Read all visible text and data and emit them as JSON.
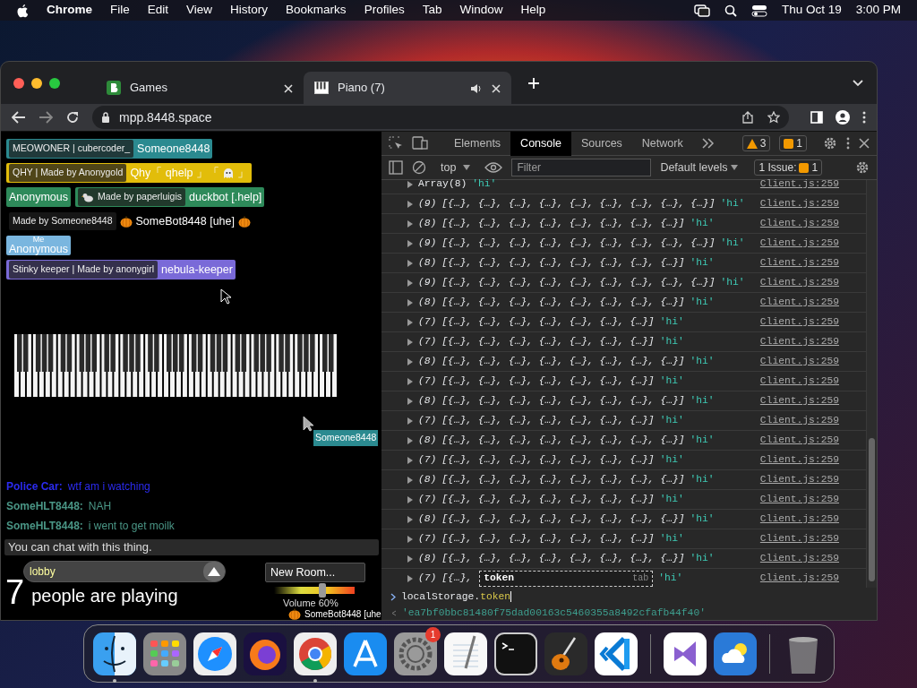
{
  "menubar": {
    "app": "Chrome",
    "menus": [
      "File",
      "Edit",
      "View",
      "History",
      "Bookmarks",
      "Profiles",
      "Tab",
      "Window",
      "Help"
    ],
    "date": "Thu Oct 19",
    "time": "3:00 PM"
  },
  "browser": {
    "tabs": [
      {
        "title": "Games",
        "selected": false,
        "audio": false
      },
      {
        "title": "Piano (7)",
        "selected": true,
        "audio": true
      }
    ],
    "address": "mpp.8448.space"
  },
  "page": {
    "participant_rows": [
      [
        {
          "tag": "MEOWONER | cubercoder_",
          "name": "Someone8448",
          "color": "#2b8a90",
          "kind": "plain"
        }
      ],
      [
        {
          "tag": "QHY | Made by Anonygold",
          "name": "Qhy「 qhelp 」「",
          "name_end": "」",
          "color": "#e2bd0a",
          "kind": "ghost"
        }
      ],
      [
        {
          "name": "Anonymous",
          "color": "#2e8a5a",
          "kind": "plain"
        },
        {
          "tag": "Made by paperluigis",
          "name": "duckbot [.help]",
          "color": "#2e8a5a",
          "kind": "duck"
        }
      ],
      [
        {
          "tag": "Made by Someone8448",
          "name": "SomeBot8448 [uhe]",
          "color": "#000000",
          "kind": "pumpkin"
        }
      ],
      [
        {
          "me": "Me",
          "name": "Anonymous",
          "color": "#7ab6df",
          "kind": "plain"
        }
      ],
      [
        {
          "tag": "Stinky keeper | Made by anonygirl",
          "name": "nebula-keeper",
          "color": "#7a6ad8",
          "kind": "plain"
        }
      ]
    ],
    "remote_cursor": {
      "name": "Someone8448",
      "color": "#2b8a90"
    },
    "chat": [
      {
        "author": "Police Car:",
        "text": "wtf am i watching",
        "color": "#2b2bf0"
      },
      {
        "author": "SomeHLT8448:",
        "text": "NAH",
        "color": "#4a9686"
      },
      {
        "author": "SomeHLT8448:",
        "text": "i went to get moilk",
        "color": "#4a9686"
      }
    ],
    "chat_input": {
      "placeholder": "You can chat with this thing."
    },
    "room": {
      "value": "lobby"
    },
    "player_count": "7",
    "player_label": "people are playing",
    "new_room_button": "New Room...",
    "volume": {
      "label": "Volume 60%",
      "level": 0.6
    },
    "notification": "SomeBot8448 [uhe"
  },
  "devtools": {
    "tabs": [
      {
        "label": "Elements",
        "selected": false
      },
      {
        "label": "Console",
        "selected": true
      },
      {
        "label": "Sources",
        "selected": false
      },
      {
        "label": "Network",
        "selected": false
      }
    ],
    "warnings": "3",
    "messages": "1",
    "context": "top",
    "filter": {
      "placeholder": "Filter"
    },
    "levels": "Default levels",
    "issues_label": "1 Issue:",
    "issues_count": "1",
    "rows": [
      {
        "count": "Array(8)",
        "items": "",
        "value": "'hi'",
        "source": "Client.js:259",
        "expanded": false
      },
      {
        "count": "(9)",
        "items": "[{…}, {…}, {…}, {…}, {…}, {…}, {…}, {…}, {…}]",
        "value": "'hi'",
        "source": "Client.js:259",
        "expanded": false
      },
      {
        "count": "(8)",
        "items": "[{…}, {…}, {…}, {…}, {…}, {…}, {…}, {…}]",
        "value": "'hi'",
        "source": "Client.js:259",
        "expanded": false
      },
      {
        "count": "(9)",
        "items": "[{…}, {…}, {…}, {…}, {…}, {…}, {…}, {…}, {…}]",
        "value": "'hi'",
        "source": "Client.js:259",
        "expanded": false
      },
      {
        "count": "(8)",
        "items": "[{…}, {…}, {…}, {…}, {…}, {…}, {…}, {…}]",
        "value": "'hi'",
        "source": "Client.js:259",
        "expanded": false
      },
      {
        "count": "(9)",
        "items": "[{…}, {…}, {…}, {…}, {…}, {…}, {…}, {…}, {…}]",
        "value": "'hi'",
        "source": "Client.js:259",
        "expanded": false
      },
      {
        "count": "(8)",
        "items": "[{…}, {…}, {…}, {…}, {…}, {…}, {…}, {…}]",
        "value": "'hi'",
        "source": "Client.js:259",
        "expanded": false
      },
      {
        "count": "(7)",
        "items": "[{…}, {…}, {…}, {…}, {…}, {…}, {…}]",
        "value": "'hi'",
        "source": "Client.js:259",
        "expanded": false
      },
      {
        "count": "(7)",
        "items": "[{…}, {…}, {…}, {…}, {…}, {…}, {…}]",
        "value": "'hi'",
        "source": "Client.js:259",
        "expanded": false
      },
      {
        "count": "(8)",
        "items": "[{…}, {…}, {…}, {…}, {…}, {…}, {…}, {…}]",
        "value": "'hi'",
        "source": "Client.js:259",
        "expanded": false
      },
      {
        "count": "(7)",
        "items": "[{…}, {…}, {…}, {…}, {…}, {…}, {…}]",
        "value": "'hi'",
        "source": "Client.js:259",
        "expanded": false
      },
      {
        "count": "(8)",
        "items": "[{…}, {…}, {…}, {…}, {…}, {…}, {…}, {…}]",
        "value": "'hi'",
        "source": "Client.js:259",
        "expanded": false
      },
      {
        "count": "(7)",
        "items": "[{…}, {…}, {…}, {…}, {…}, {…}, {…}]",
        "value": "'hi'",
        "source": "Client.js:259",
        "expanded": false
      },
      {
        "count": "(8)",
        "items": "[{…}, {…}, {…}, {…}, {…}, {…}, {…}, {…}]",
        "value": "'hi'",
        "source": "Client.js:259",
        "expanded": false
      },
      {
        "count": "(7)",
        "items": "[{…}, {…}, {…}, {…}, {…}, {…}, {…}]",
        "value": "'hi'",
        "source": "Client.js:259",
        "expanded": false
      },
      {
        "count": "(8)",
        "items": "[{…}, {…}, {…}, {…}, {…}, {…}, {…}, {…}]",
        "value": "'hi'",
        "source": "Client.js:259",
        "expanded": false
      },
      {
        "count": "(7)",
        "items": "[{…}, {…}, {…}, {…}, {…}, {…}, {…}]",
        "value": "'hi'",
        "source": "Client.js:259",
        "expanded": false
      },
      {
        "count": "(8)",
        "items": "[{…}, {…}, {…}, {…}, {…}, {…}, {…}, {…}]",
        "value": "'hi'",
        "source": "Client.js:259",
        "expanded": false
      },
      {
        "count": "(7)",
        "items": "[{…}, {…}, {…}, {…}, {…}, {…}, {…}]",
        "value": "'hi'",
        "source": "Client.js:259",
        "expanded": false
      },
      {
        "count": "(8)",
        "items": "[{…}, {…}, {…}, {…}, {…}, {…}, {…}, {…}]",
        "value": "'hi'",
        "source": "Client.js:259",
        "expanded": false
      },
      {
        "count": "(7)",
        "items": "[{…},",
        "value": "'hi'",
        "source": "Client.js:259",
        "expanded": false
      }
    ],
    "autocomplete": {
      "suggestion": "token",
      "hint": "tab"
    },
    "prompt": {
      "object": "localStorage.",
      "property": "token"
    },
    "result": "'ea7bf0bbc81480f75dad00163c5460355a8492cfafb44f40'"
  },
  "dock": {
    "apps": [
      {
        "running": true
      },
      {
        "running": false
      },
      {
        "running": false
      },
      {
        "running": false
      },
      {
        "running": true
      },
      {
        "running": false
      },
      {
        "running": false,
        "badge": "1"
      },
      {
        "running": false
      },
      {
        "running": false
      },
      {
        "running": false
      },
      {
        "running": false
      },
      {
        "running": false
      },
      {
        "running": false
      },
      {
        "running": false
      }
    ]
  }
}
